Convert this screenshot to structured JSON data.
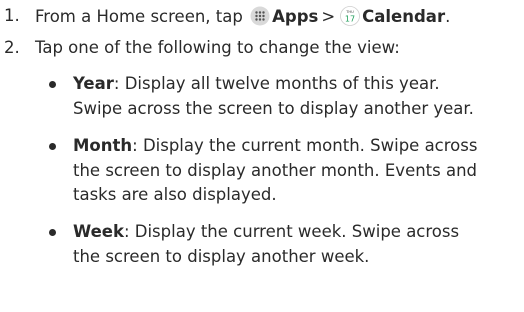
{
  "steps": [
    {
      "number": "1.",
      "prefix": "From a Home screen, tap",
      "apps_label": "Apps",
      "separator": ">",
      "calendar_label": "Calendar",
      "calendar_icon_day": "THU",
      "calendar_icon_date": "17"
    },
    {
      "number": "2.",
      "text": "Tap one of the following to change the view:"
    }
  ],
  "bullets": [
    {
      "term": "Year",
      "line1": ": Display all twelve months of this year.",
      "line2": "Swipe across the screen to display another year."
    },
    {
      "term": "Month",
      "line1": ": Display the current month. Swipe across",
      "line2": "the screen to display another month. Events and",
      "line3": "tasks are also displayed."
    },
    {
      "term": "Week",
      "line1": ": Display the current week. Swipe across",
      "line2": "the screen to display another week."
    }
  ],
  "colors": {
    "text": "#2a2a2a",
    "apps_icon_bg": "#d9d9d9",
    "calendar_accent": "#1f9e5a"
  },
  "icons": {
    "apps": "apps-grid-icon",
    "calendar": "calendar-icon"
  }
}
